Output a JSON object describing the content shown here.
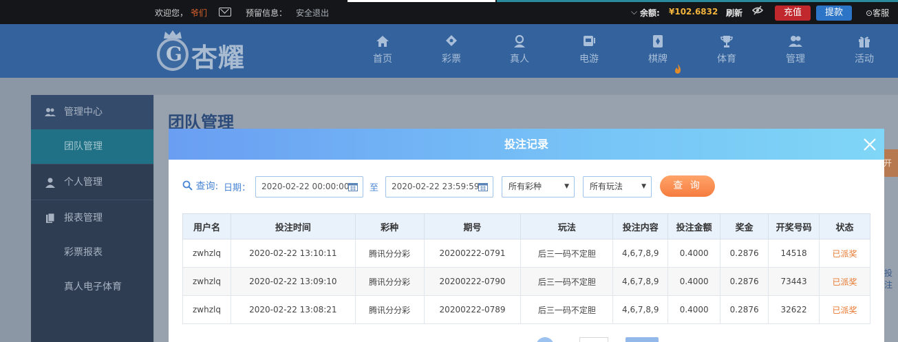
{
  "topbar": {
    "welcome": "欢迎您，",
    "username": "爷们",
    "notice_label": "预留信息：",
    "logout": "安全退出",
    "balance_label": "余额:",
    "balance_value": "¥102.6832",
    "refresh": "刷新",
    "recharge": "充值",
    "withdraw": "提款",
    "service": "客服"
  },
  "brand": {
    "logo_text": "杏耀"
  },
  "nav": [
    {
      "label": "首页",
      "icon": "home-icon"
    },
    {
      "label": "彩票",
      "icon": "lottery-icon"
    },
    {
      "label": "真人",
      "icon": "live-dealer-icon"
    },
    {
      "label": "电游",
      "icon": "slot-machine-icon"
    },
    {
      "label": "棋牌",
      "icon": "cards-icon"
    },
    {
      "label": "体育",
      "icon": "trophy-icon"
    },
    {
      "label": "管理",
      "icon": "users-icon"
    },
    {
      "label": "活动",
      "icon": "gift-icon"
    }
  ],
  "sidebar": {
    "items": [
      {
        "label": "管理中心"
      },
      {
        "label": "团队管理"
      },
      {
        "label": "个人管理"
      },
      {
        "label": "报表管理"
      },
      {
        "label": "彩票报表"
      },
      {
        "label": "真人电子体育"
      }
    ]
  },
  "page": {
    "title": "团队管理",
    "side_button": "开户",
    "side_link": "投注"
  },
  "modal": {
    "title": "投注记录",
    "query_label": "查询:",
    "date_label": "日期：",
    "start_date": "2020-02-22 00:00:00",
    "to_label": "至",
    "end_date": "2020-02-22 23:59:59",
    "lottery_select": "所有彩种",
    "play_select": "所有玩法",
    "query_button": "查 询",
    "columns": [
      "用户名",
      "投注时间",
      "彩种",
      "期号",
      "玩法",
      "投注内容",
      "投注金额",
      "奖金",
      "开奖号码",
      "状态"
    ],
    "rows": [
      {
        "user": "zwhzlq",
        "time": "2020-02-22 13:10:11",
        "lottery": "腾讯分分彩",
        "issue": "20200222-0791",
        "play": "后三一码不定胆",
        "content": "4,6,7,8,9",
        "amount": "0.4000",
        "bonus": "0.2876",
        "result": "14518",
        "status": "已派奖"
      },
      {
        "user": "zwhzlq",
        "time": "2020-02-22 13:09:10",
        "lottery": "腾讯分分彩",
        "issue": "20200222-0790",
        "play": "后三一码不定胆",
        "content": "4,6,7,8,9",
        "amount": "0.4000",
        "bonus": "0.2876",
        "result": "73443",
        "status": "已派奖"
      },
      {
        "user": "zwhzlq",
        "time": "2020-02-22 13:08:21",
        "lottery": "腾讯分分彩",
        "issue": "20200222-0789",
        "play": "后三一码不定胆",
        "content": "4,6,7,8,9",
        "amount": "0.4000",
        "bonus": "0.2876",
        "result": "32622",
        "status": "已派奖"
      }
    ]
  }
}
